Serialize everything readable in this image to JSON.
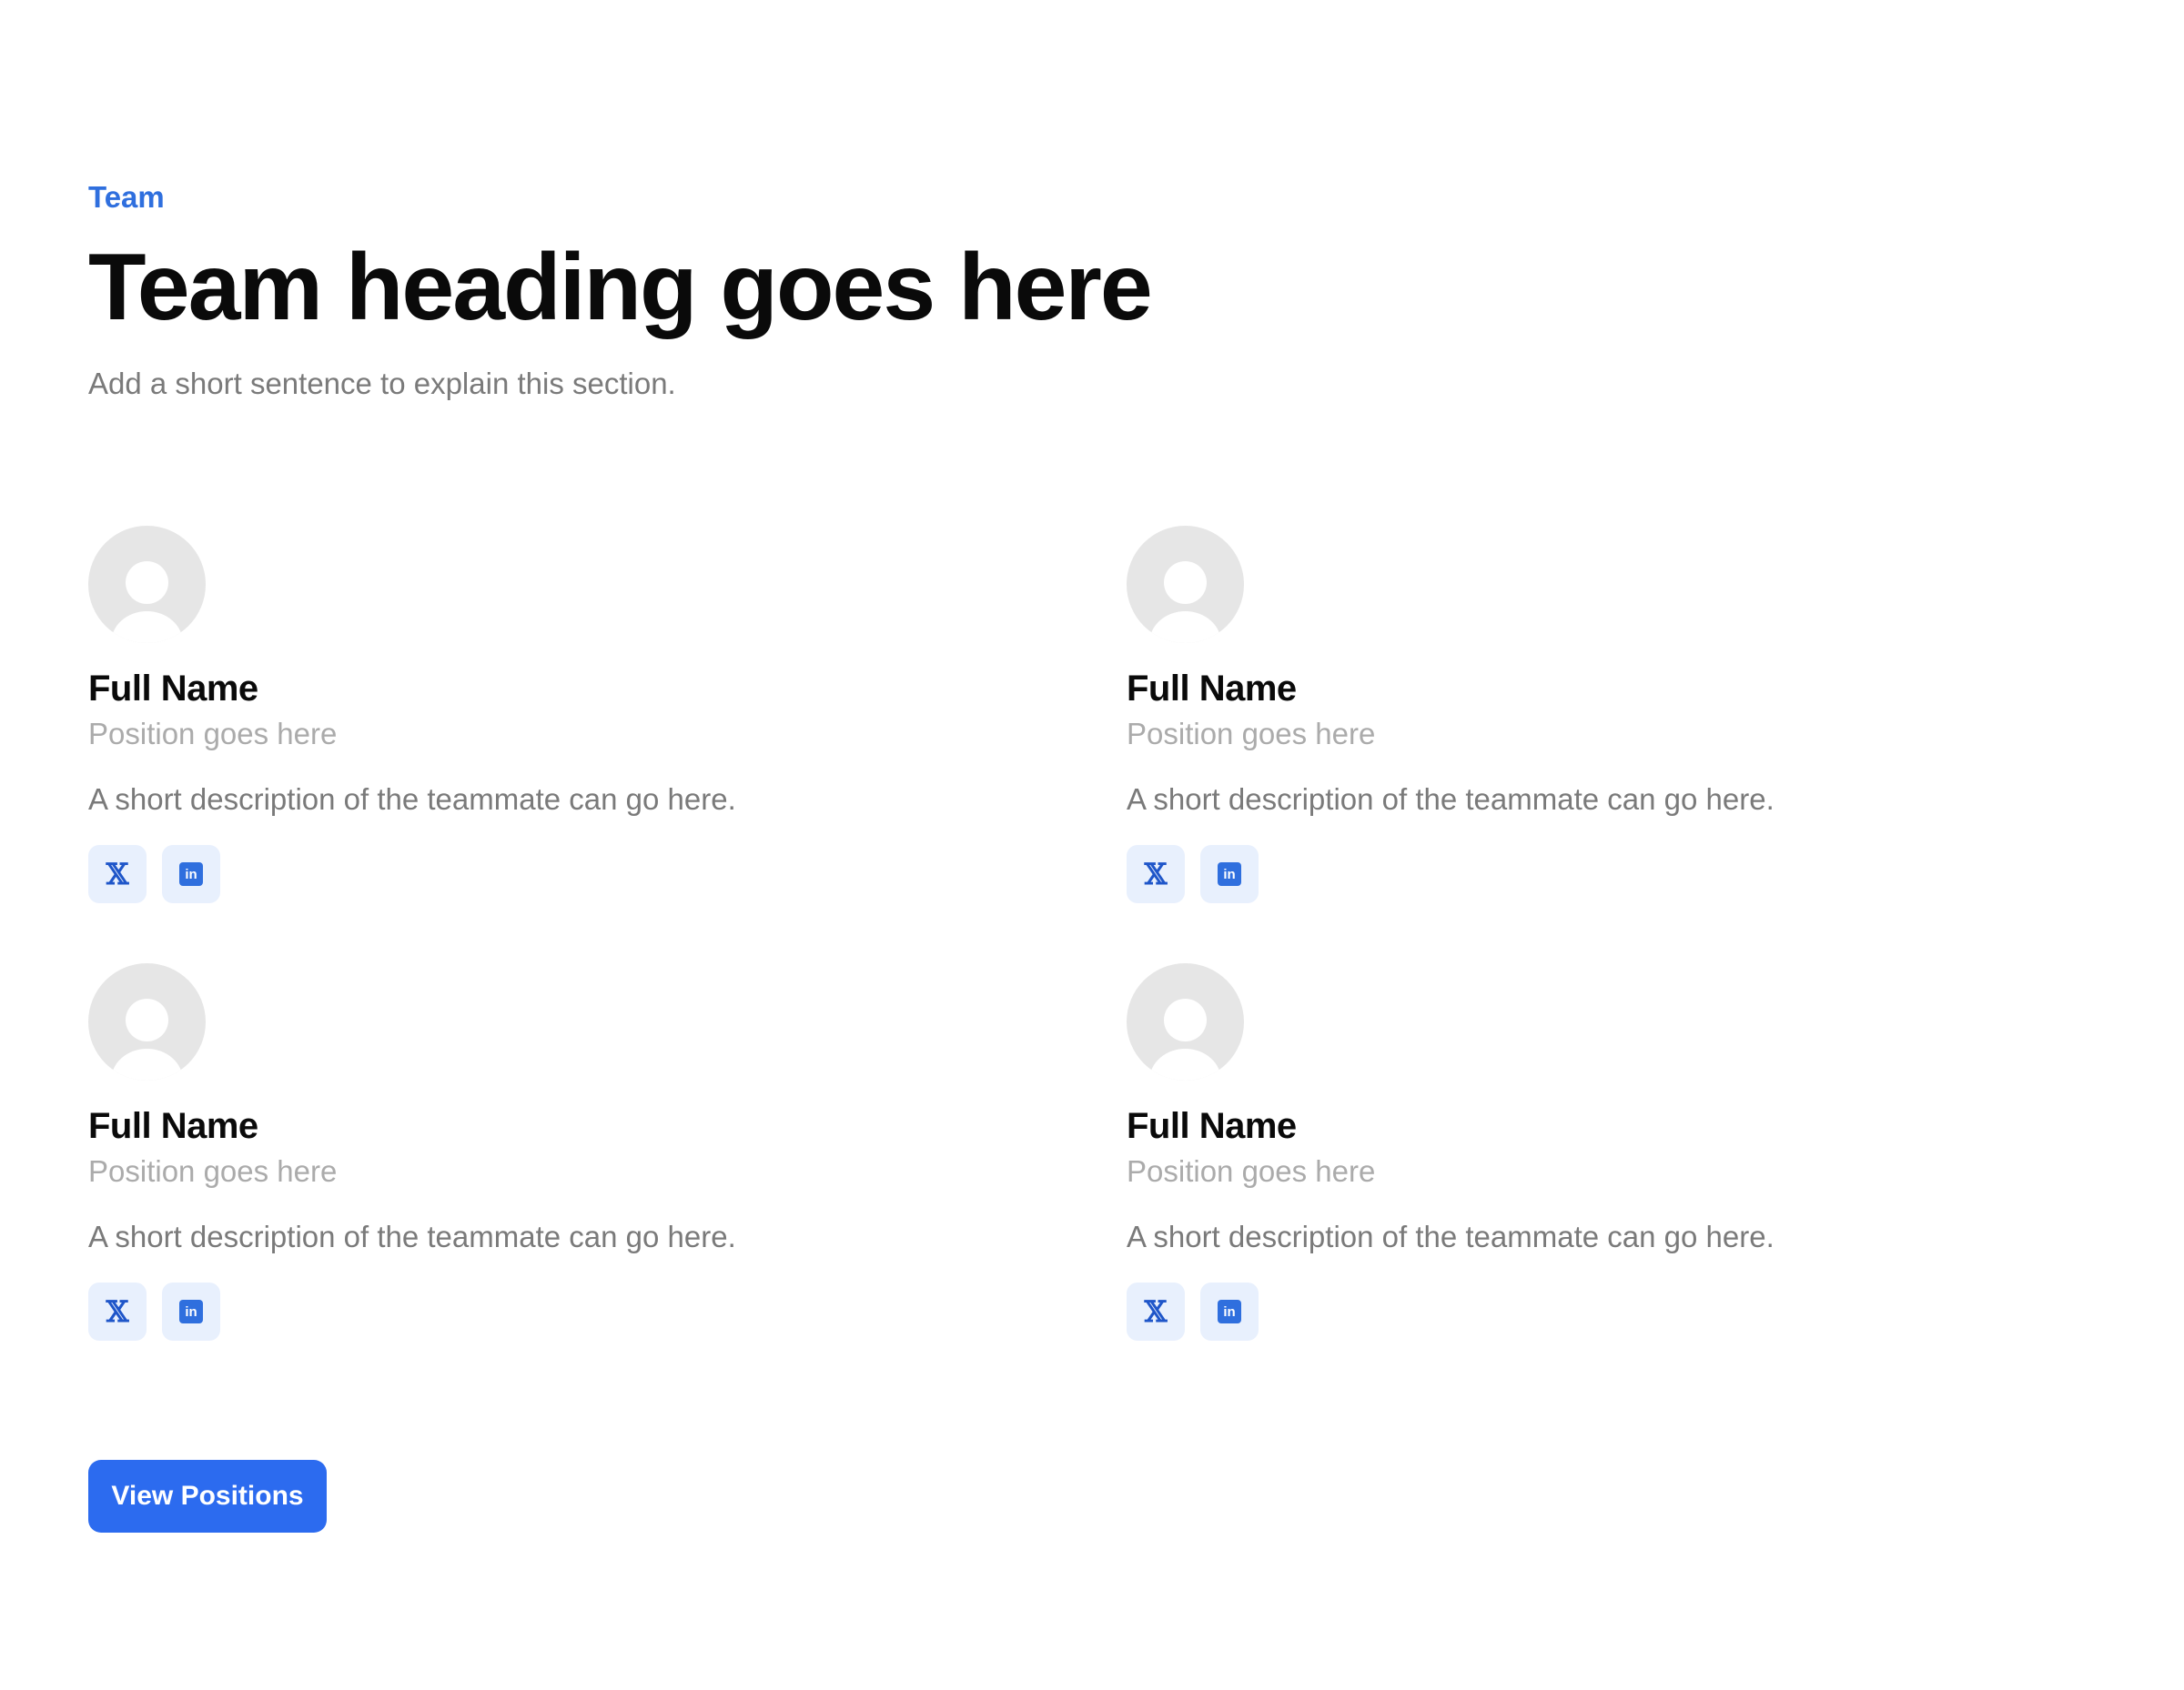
{
  "section": {
    "eyebrow": "Team",
    "heading": "Team heading goes here",
    "subtitle": "Add a short sentence to explain this section."
  },
  "members": [
    {
      "name": "Full Name",
      "position": "Position goes here",
      "description": "A short description of the teammate can go here.",
      "socials": {
        "x_icon": "x-icon",
        "linkedin_icon": "linkedin-icon",
        "linkedin_glyph": "in"
      }
    },
    {
      "name": "Full Name",
      "position": "Position goes here",
      "description": "A short description of the teammate can go here.",
      "socials": {
        "x_icon": "x-icon",
        "linkedin_icon": "linkedin-icon",
        "linkedin_glyph": "in"
      }
    },
    {
      "name": "Full Name",
      "position": "Position goes here",
      "description": "A short description of the teammate can go here.",
      "socials": {
        "x_icon": "x-icon",
        "linkedin_icon": "linkedin-icon",
        "linkedin_glyph": "in"
      }
    },
    {
      "name": "Full Name",
      "position": "Position goes here",
      "description": "A short description of the teammate can go here.",
      "socials": {
        "x_icon": "x-icon",
        "linkedin_icon": "linkedin-icon",
        "linkedin_glyph": "in"
      }
    }
  ],
  "cta": {
    "label": "View Positions"
  },
  "colors": {
    "accent": "#2f6fde",
    "button": "#2c6bef",
    "social_bg": "#e8f0fd",
    "heading": "#0a0a0a",
    "muted": "#7a7a7a",
    "subtle": "#ababab",
    "avatar_bg": "#e6e6e6"
  }
}
